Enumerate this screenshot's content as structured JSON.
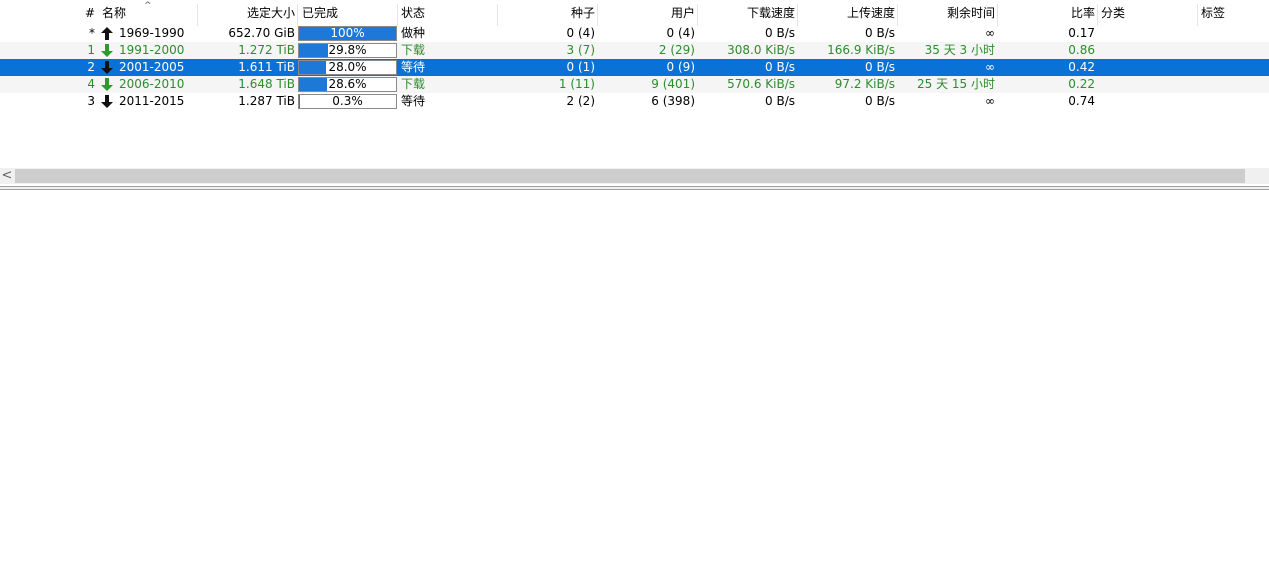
{
  "columns": {
    "num": "#",
    "name": "名称",
    "size": "选定大小",
    "done": "已完成",
    "status": "状态",
    "seeds": "种子",
    "peers": "用户",
    "dlspeed": "下载速度",
    "upspeed": "上传速度",
    "eta": "剩余时间",
    "ratio": "比率",
    "category": "分类",
    "tags": "标签"
  },
  "sort_indicator": "^",
  "rows": [
    {
      "num": "*",
      "direction": "up",
      "name": "1969-1990",
      "size": "652.70 GiB",
      "progress": 100,
      "progress_text": "100%",
      "status": "做种",
      "seeds": "0 (4)",
      "peers": "0 (4)",
      "dlspeed": "0 B/s",
      "upspeed": "0 B/s",
      "eta": "∞",
      "ratio": "0.17"
    },
    {
      "num": "1",
      "direction": "down",
      "name": "1991-2000",
      "size": "1.272 TiB",
      "progress": 29.8,
      "progress_text": "29.8%",
      "status": "下载",
      "seeds": "3 (7)",
      "peers": "2 (29)",
      "dlspeed": "308.0 KiB/s",
      "upspeed": "166.9 KiB/s",
      "eta": "35 天 3 小时",
      "ratio": "0.86"
    },
    {
      "num": "2",
      "direction": "down",
      "name": "2001-2005",
      "size": "1.611 TiB",
      "progress": 28.0,
      "progress_text": "28.0%",
      "status": "等待",
      "seeds": "0 (1)",
      "peers": "0 (9)",
      "dlspeed": "0 B/s",
      "upspeed": "0 B/s",
      "eta": "∞",
      "ratio": "0.42"
    },
    {
      "num": "4",
      "direction": "down",
      "name": "2006-2010",
      "size": "1.648 TiB",
      "progress": 28.6,
      "progress_text": "28.6%",
      "status": "下载",
      "seeds": "1 (11)",
      "peers": "9 (401)",
      "dlspeed": "570.6 KiB/s",
      "upspeed": "97.2 KiB/s",
      "eta": "25 天 15 小时",
      "ratio": "0.22"
    },
    {
      "num": "3",
      "direction": "down",
      "name": "2011-2015",
      "size": "1.287 TiB",
      "progress": 0.3,
      "progress_text": "0.3%",
      "status": "等待",
      "seeds": "2 (2)",
      "peers": "6 (398)",
      "dlspeed": "0 B/s",
      "upspeed": "0 B/s",
      "eta": "∞",
      "ratio": "0.74"
    }
  ],
  "scrollbar": {
    "left_arrow": "<"
  },
  "colors": {
    "selected_row": "#0a72d6",
    "downloading_text": "#2e8b2e",
    "progress_fill": "#1e78d7"
  }
}
